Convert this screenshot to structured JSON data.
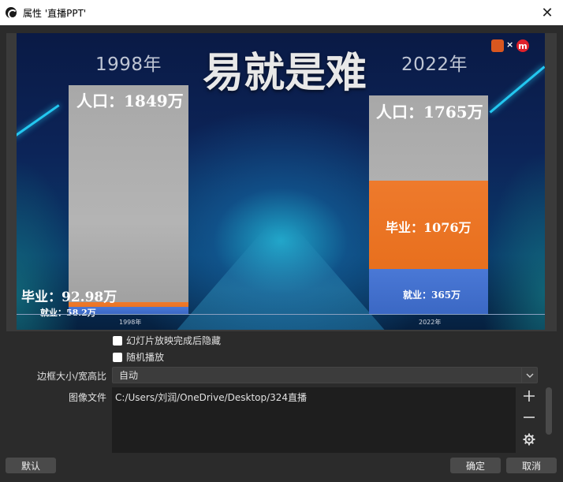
{
  "window": {
    "title": "属性 '直播PPT'",
    "close_glyph": "✕"
  },
  "slide": {
    "headline": "易就是难",
    "year_left": "1998年",
    "year_right": "2022年",
    "logo_x": "×",
    "logo_m": "m",
    "axis_left": "1998年",
    "axis_right": "2022年",
    "bars": {
      "left": {
        "population_label": "人口：1849万",
        "graduates_label": "毕业：92.98万",
        "employed_label": "就业：58.2万"
      },
      "right": {
        "population_label": "人口：1765万",
        "graduates_label": "毕业：1076万",
        "employed_label": "就业：365万"
      }
    }
  },
  "chart_data": {
    "type": "bar",
    "categories": [
      "1998年",
      "2022年"
    ],
    "series": [
      {
        "name": "人口",
        "values": [
          1849,
          1765
        ]
      },
      {
        "name": "毕业",
        "values": [
          92.98,
          1076
        ]
      },
      {
        "name": "就业",
        "values": [
          58.2,
          365
        ]
      }
    ],
    "title": "易就是难",
    "xlabel": "",
    "ylabel": "",
    "units": "万"
  },
  "colors": {
    "population": "#a9a9a9",
    "graduates": "#ee7a2c",
    "employed": "#3b68c4"
  },
  "options": {
    "hide_after_done": "幻灯片放映完成后隐藏",
    "random_play": "随机播放"
  },
  "form": {
    "size_label": "边框大小/宽高比",
    "size_value": "自动",
    "files_label": "图像文件",
    "file_path": "C:/Users/刘润/OneDrive/Desktop/324直播"
  },
  "buttons": {
    "defaults": "默认",
    "ok": "确定",
    "cancel": "取消"
  }
}
